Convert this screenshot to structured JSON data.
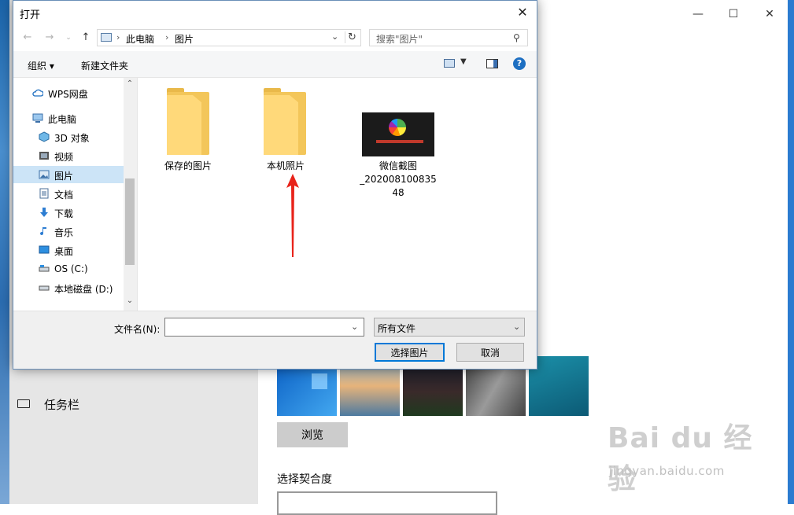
{
  "dialog": {
    "title": "打开",
    "close_glyph": "✕"
  },
  "address": {
    "crumbs": [
      "此电脑",
      "图片"
    ],
    "separator": "›"
  },
  "search": {
    "placeholder": "搜索\"图片\""
  },
  "toolbar": {
    "organize_label": "组织 ▾",
    "new_folder_label": "新建文件夹",
    "help_glyph": "?"
  },
  "nav": {
    "items": [
      {
        "label": "WPS网盘",
        "icon": "cloud-icon"
      },
      {
        "label": "此电脑",
        "icon": "computer-icon"
      },
      {
        "label": "3D 对象",
        "icon": "cube-icon"
      },
      {
        "label": "视频",
        "icon": "video-icon"
      },
      {
        "label": "图片",
        "icon": "pictures-icon",
        "selected": true
      },
      {
        "label": "文档",
        "icon": "documents-icon"
      },
      {
        "label": "下载",
        "icon": "download-icon"
      },
      {
        "label": "音乐",
        "icon": "music-icon"
      },
      {
        "label": "桌面",
        "icon": "desktop-icon"
      },
      {
        "label": "OS (C:)",
        "icon": "drive-icon"
      },
      {
        "label": "本地磁盘 (D:)",
        "icon": "drive-icon"
      }
    ]
  },
  "files": [
    {
      "name": "保存的图片",
      "type": "folder"
    },
    {
      "name": "本机照片",
      "type": "folder"
    },
    {
      "name_lines": [
        "微信截图",
        "_202008100835",
        "48"
      ],
      "type": "image"
    }
  ],
  "bottom": {
    "filename_label": "文件名(N):",
    "filename_value": "",
    "filter_value": "所有文件",
    "ok_label": "选择图片",
    "cancel_label": "取消"
  },
  "background_app": {
    "taskbar_label": "任务栏",
    "browse_label": "浏览",
    "fit_label": "选择契合度"
  },
  "watermark": {
    "brand": "Bai du 经验",
    "url": "jingyan.baidu.com"
  },
  "colors": {
    "accent": "#0078d7",
    "selected_bg": "#cce4f7",
    "folder": "#f3c65a",
    "annotation_arrow": "#e8231a"
  }
}
